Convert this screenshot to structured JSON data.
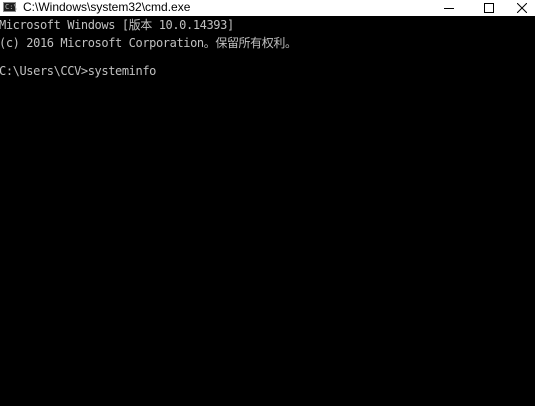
{
  "window": {
    "title": "C:\\Windows\\system32\\cmd.exe",
    "icon": "cmd-icon",
    "icon_glyph": "C:\\",
    "controls": {
      "minimize": "minimize-icon",
      "maximize": "maximize-icon",
      "close": "close-icon"
    }
  },
  "console": {
    "lines": [
      "Microsoft Windows [版本 10.0.14393]",
      "(c) 2016 Microsoft Corporation。保留所有权利。",
      "C:\\Users\\CCV>systeminfo"
    ],
    "background": "#000000",
    "foreground": "#c0c0c0"
  }
}
